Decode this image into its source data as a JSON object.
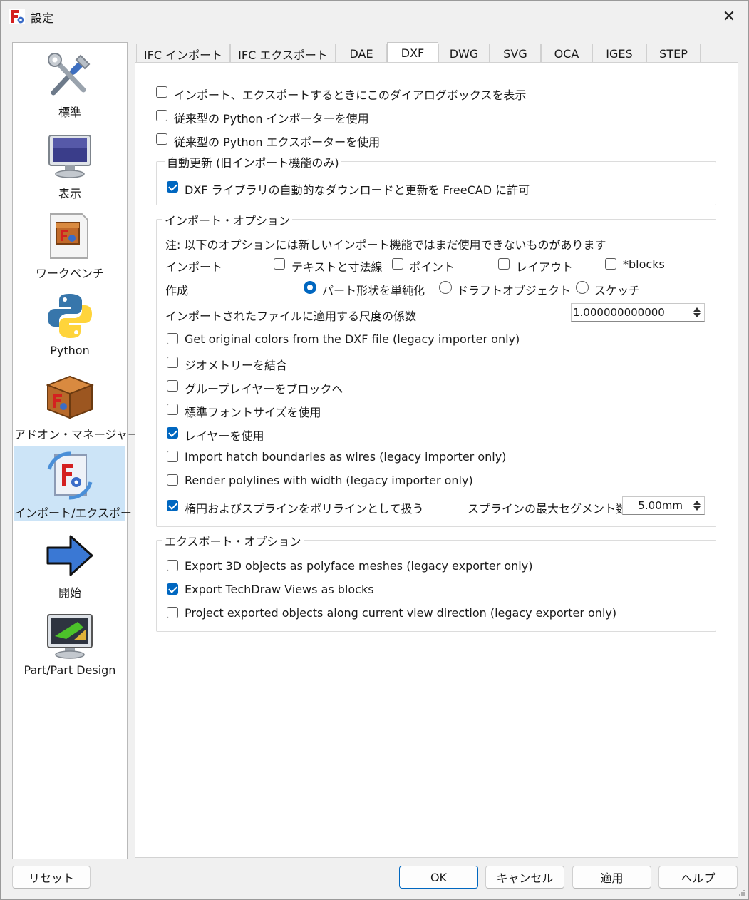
{
  "window": {
    "title": "設定",
    "close_glyph": "✕"
  },
  "sidebar": {
    "items": [
      {
        "label": "標準",
        "icon": "tools-icon"
      },
      {
        "label": "表示",
        "icon": "monitor-icon"
      },
      {
        "label": "ワークベンチ",
        "icon": "workbench-icon"
      },
      {
        "label": "Python",
        "icon": "python-icon"
      },
      {
        "label": "アドオン・マネージャー",
        "icon": "addon-box-icon"
      },
      {
        "label": "インポート/エクスポート",
        "icon": "import-export-icon",
        "selected": true
      },
      {
        "label": "開始",
        "icon": "arrow-right-icon"
      },
      {
        "label": "Part/Part Design",
        "icon": "part-design-icon"
      }
    ]
  },
  "tabs": [
    {
      "label": "IFC インポート"
    },
    {
      "label": "IFC エクスポート"
    },
    {
      "label": "DAE"
    },
    {
      "label": "DXF",
      "active": true
    },
    {
      "label": "DWG"
    },
    {
      "label": "SVG"
    },
    {
      "label": "OCA"
    },
    {
      "label": "IGES"
    },
    {
      "label": "STEP"
    }
  ],
  "top_options": [
    {
      "label": "インポート、エクスポートするときにこのダイアログボックスを表示",
      "checked": false
    },
    {
      "label": "従来型の Python インポーターを使用",
      "checked": false
    },
    {
      "label": "従来型の Python エクスポーターを使用",
      "checked": false
    }
  ],
  "auto_update": {
    "title": "自動更新 (旧インポート機能のみ)",
    "option": {
      "label": "DXF ライブラリの自動的なダウンロードと更新を FreeCAD に許可",
      "checked": true
    }
  },
  "import_options": {
    "title": "インポート・オプション",
    "note": "注: 以下のオプションには新しいインポート機能ではまだ使用できないものがあります",
    "import_label": "インポート",
    "import_items": [
      {
        "label": "テキストと寸法線",
        "checked": false
      },
      {
        "label": "ポイント",
        "checked": false
      },
      {
        "label": "レイアウト",
        "checked": false
      },
      {
        "label": "*blocks",
        "checked": false
      }
    ],
    "create_label": "作成",
    "create_items": [
      {
        "label": "パート形状を単純化",
        "selected": true
      },
      {
        "label": "ドラフトオブジェクト",
        "selected": false
      },
      {
        "label": "スケッチ",
        "selected": false
      }
    ],
    "scale_label": "インポートされたファイルに適用する尺度の係数",
    "scale_value": "1.000000000000",
    "checks": [
      {
        "label": "Get original colors from the DXF file (legacy importer only)",
        "checked": false
      },
      {
        "label": "ジオメトリーを結合",
        "checked": false
      },
      {
        "label": "グループレイヤーをブロックへ",
        "checked": false
      },
      {
        "label": "標準フォントサイズを使用",
        "checked": false
      },
      {
        "label": "レイヤーを使用",
        "checked": true
      },
      {
        "label": "Import hatch boundaries as wires (legacy importer only)",
        "checked": false
      },
      {
        "label": "Render polylines with width (legacy importer only)",
        "checked": false
      },
      {
        "label": "楕円およびスプラインをポリラインとして扱う",
        "checked": true
      }
    ],
    "segments_label": "スプラインの最大セグメント数:",
    "segments_value": "5.00mm"
  },
  "export_options": {
    "title": "エクスポート・オプション",
    "checks": [
      {
        "label": "Export 3D objects as polyface meshes (legacy exporter only)",
        "checked": false
      },
      {
        "label": "Export TechDraw Views as blocks",
        "checked": true
      },
      {
        "label": "Project exported objects along current view direction (legacy exporter only)",
        "checked": false
      }
    ]
  },
  "buttons": {
    "reset": "リセット",
    "ok": "OK",
    "cancel": "キャンセル",
    "apply": "適用",
    "help": "ヘルプ"
  },
  "colors": {
    "accent": "#0067c0",
    "selection": "#cce4f7"
  }
}
